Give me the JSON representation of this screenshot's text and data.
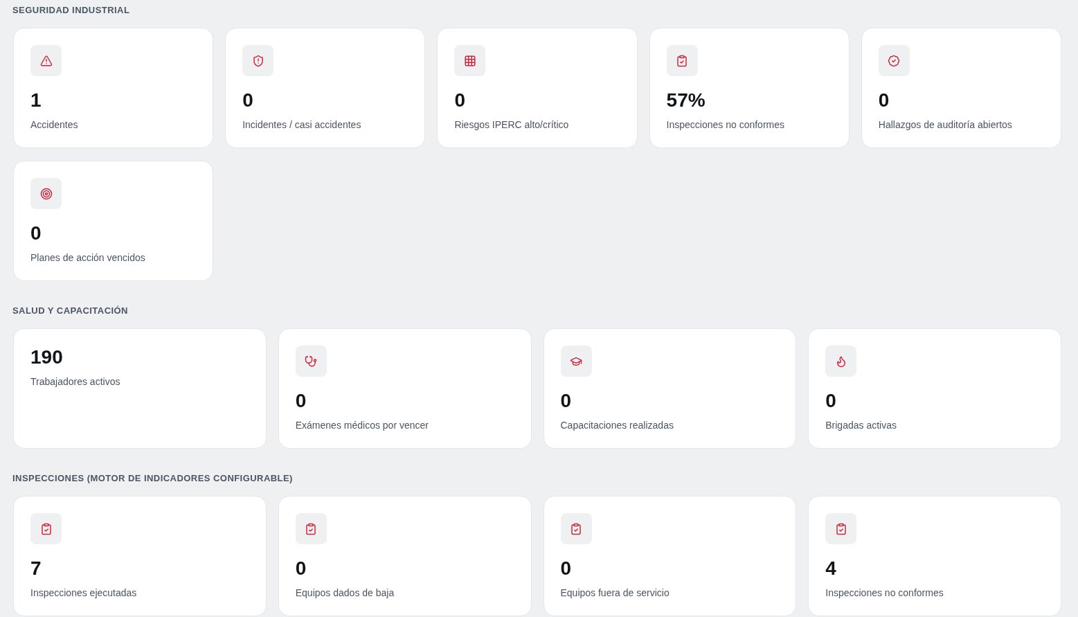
{
  "sections": [
    {
      "title": "SEGURIDAD INDUSTRIAL",
      "cards": [
        {
          "kind": "icon",
          "value": "1",
          "label": "Accidentes"
        },
        {
          "kind": "icon",
          "value": "0",
          "label": "Incidentes / casi accidentes"
        },
        {
          "kind": "icon",
          "value": "0",
          "label": "Riesgos IPERC alto/crítico"
        },
        {
          "kind": "icon",
          "value": "57%",
          "label": "Inspecciones no conformes"
        },
        {
          "kind": "icon",
          "value": "0",
          "label": "Hallazgos de auditoría abiertos"
        },
        {
          "kind": "icon",
          "value": "0",
          "label": "Planes de acción vencidos"
        }
      ]
    },
    {
      "title": "SALUD Y CAPACITACIÓN",
      "cards": [
        {
          "kind": "plain",
          "value": "190",
          "label": "Trabajadores activos"
        },
        {
          "kind": "icon",
          "value": "0",
          "label": "Exámenes médicos por vencer"
        },
        {
          "kind": "icon",
          "value": "0",
          "label": "Capacitaciones realizadas"
        },
        {
          "kind": "icon",
          "value": "0",
          "label": "Brigadas activas"
        }
      ]
    },
    {
      "title": "INSPECCIONES (MOTOR DE INDICADORES CONFIGURABLE)",
      "cards": [
        {
          "kind": "icon",
          "value": "7",
          "label": "Inspecciones ejecutadas"
        },
        {
          "kind": "icon",
          "value": "0",
          "label": "Equipos dados de baja"
        },
        {
          "kind": "icon",
          "value": "0",
          "label": "Equipos fuera de servicio"
        },
        {
          "kind": "icon",
          "value": "4",
          "label": "Inspecciones no conformes"
        }
      ]
    }
  ]
}
